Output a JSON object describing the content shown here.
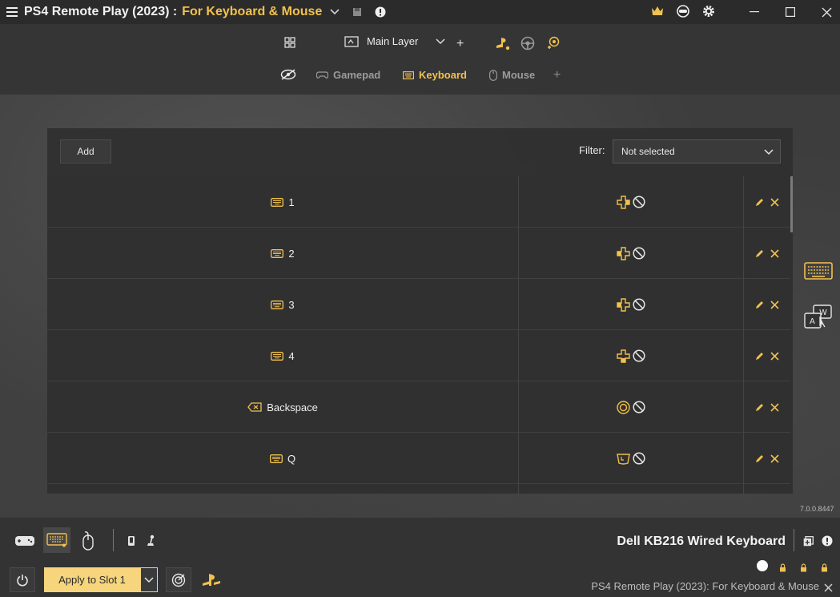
{
  "titlebar": {
    "app_title": "PS4 Remote Play (2023) :",
    "profile_name": "For Keyboard & Mouse",
    "icons": [
      "menu-icon",
      "chevron-down-icon",
      "save-icon",
      "info-icon",
      "crown-icon",
      "remote-icon",
      "gear-icon",
      "minimize-icon",
      "maximize-icon",
      "close-icon"
    ],
    "accent_color": "#f2c14e"
  },
  "toolbar": {
    "layer_label": "Main Layer",
    "tabs": [
      {
        "label": "Gamepad",
        "active": false
      },
      {
        "label": "Keyboard",
        "active": true
      },
      {
        "label": "Mouse",
        "active": false
      }
    ]
  },
  "panel": {
    "add_label": "Add",
    "filter_label": "Filter:",
    "filter_value": "Not selected",
    "rows": [
      {
        "key": "1",
        "key_icon": "keyboard-icon",
        "mapping_icon": "dpad-right-icon"
      },
      {
        "key": "2",
        "key_icon": "keyboard-icon",
        "mapping_icon": "dpad-left-icon"
      },
      {
        "key": "3",
        "key_icon": "keyboard-icon",
        "mapping_icon": "dpad-up-icon"
      },
      {
        "key": "4",
        "key_icon": "keyboard-icon",
        "mapping_icon": "dpad-down-icon"
      },
      {
        "key": "Backspace",
        "key_icon": "backspace-icon",
        "mapping_icon": "circle-button-icon"
      },
      {
        "key": "Q",
        "key_icon": "keyboard-icon",
        "mapping_icon": "trigger-icon"
      }
    ]
  },
  "version": "7.0.0.8447",
  "bottom": {
    "device_name": "Dell KB216 Wired Keyboard",
    "apply_label": "Apply to Slot 1",
    "status_text": "PS4 Remote Play (2023): For Keyboard & Mouse"
  }
}
